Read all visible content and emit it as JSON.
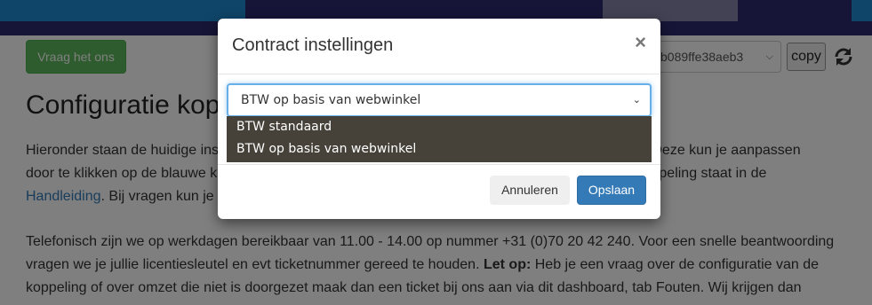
{
  "header": {
    "ask_button_label": "Vraag het ons",
    "license_select_value": "b089ffe38aeb3",
    "copy_button_label": "copy",
    "refresh_icon": "refresh-icon"
  },
  "page": {
    "title": "Configuratie koppe",
    "para1_part1": "Hieronder staan de huidige ins",
    "para1_part2": "kkt. Deze kun je aanpassen",
    "para1_line2a": "door te klikken op de blauwe k",
    "para1_line2b": "e koppeling staat in de",
    "para1_link": "Handleiding",
    "para1_line3": ". Bij vragen kun je",
    "para2_line1": "Telefonisch zijn we op werkdagen bereikbaar van 11.00 - 14.00 op nummer +31 (0)70 20 42 240. Voor een snelle beantwoording",
    "para2_line2a": "vragen we je jullie licentiesleutel en evt ticketnummer gereed te houden. ",
    "para2_bold": "Let op:",
    "para2_line2b": " Heb je een vraag over de configuratie van de",
    "para2_line3": "koppeling of over omzet die niet is doorgezet maak dan een ticket bij ons aan via dit dashboard, tab Fouten. Wij krijgen dan"
  },
  "modal": {
    "title": "Contract instellingen",
    "close_symbol": "×",
    "select_value": "BTW op basis van webwinkel",
    "options": [
      "BTW standaard",
      "BTW op basis van webwinkel"
    ],
    "cancel_label": "Annuleren",
    "save_label": "Opslaan"
  },
  "colors": {
    "nav_dark": "#2c2a6e",
    "nav_blue": "#1f8ad0",
    "green_button": "#5cb85c",
    "primary_button": "#337ab7",
    "dropdown_bg": "#46423a"
  }
}
